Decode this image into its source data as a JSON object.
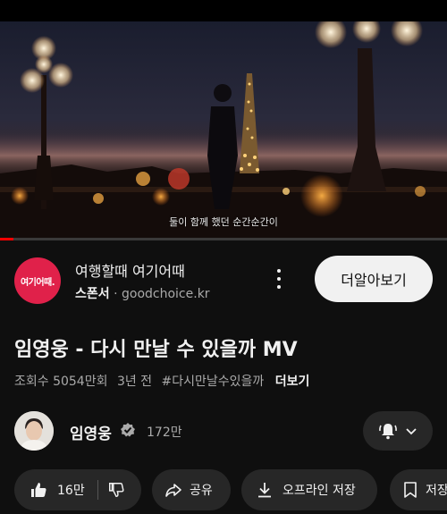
{
  "video": {
    "subtitle": "둘이 함께 했던 순간순간이",
    "progress_fraction": 0.03
  },
  "ad": {
    "logo_text": "여기어때.",
    "title": "여행할때 여기어때",
    "sponsor_label": "스폰서",
    "separator": "·",
    "url": "goodchoice.kr",
    "cta_label": "더알아보기"
  },
  "video_info": {
    "title": "임영웅 - 다시 만날 수 있을까 MV",
    "views": "조회수 5054만회",
    "age": "3년 전",
    "hashtag": "#다시만날수있을까",
    "more_label": "더보기"
  },
  "channel": {
    "name": "임영웅",
    "subscribers": "172만"
  },
  "actions": {
    "like_count": "16만",
    "share_label": "공유",
    "offline_label": "오프라인 저장",
    "save_label": "저장"
  },
  "icons": {
    "like": "thumbs-up-icon",
    "dislike": "thumbs-down-icon",
    "share": "share-arrow-icon",
    "download": "download-icon",
    "save": "bookmark-icon",
    "bell": "bell-ringing-icon",
    "verified": "verified-check-icon"
  },
  "colors": {
    "background": "#0f0f0f",
    "pill": "#272727",
    "ad_brand": "#e0214a",
    "secondary_text": "#aaaaaa"
  }
}
